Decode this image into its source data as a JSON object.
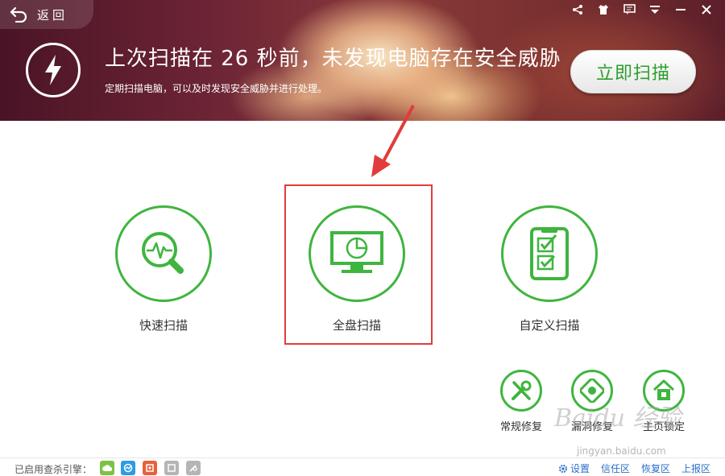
{
  "header": {
    "back_label": "返回",
    "title": "上次扫描在 26 秒前，未发现电脑存在安全威胁",
    "subtitle": "定期扫描电脑，可以及时发现安全威胁并进行处理。",
    "scan_now_label": "立即扫描"
  },
  "window_controls": [
    "share-icon",
    "skin-icon",
    "feedback-icon",
    "menu-icon",
    "minimize-icon",
    "close-icon"
  ],
  "scan_options": [
    {
      "label": "快速扫描",
      "icon": "pulse-magnifier-icon"
    },
    {
      "label": "全盘扫描",
      "icon": "monitor-icon",
      "highlighted": true
    },
    {
      "label": "自定义扫描",
      "icon": "checklist-icon"
    }
  ],
  "tools": [
    {
      "label": "常规修复",
      "icon": "wrench-screwdriver-icon"
    },
    {
      "label": "漏洞修复",
      "icon": "shield-patch-icon"
    },
    {
      "label": "主页锁定",
      "icon": "home-lock-icon"
    }
  ],
  "watermark": {
    "logo": "Baidu 经验",
    "url": "jingyan.baidu.com"
  },
  "footer": {
    "engines_label": "已启用查杀引擎：",
    "engines": [
      {
        "name": "cloud-engine-icon",
        "color": "#7dc243"
      },
      {
        "name": "qvm-engine-icon",
        "color": "#2f9be3"
      },
      {
        "name": "qex-engine-icon",
        "color": "#e8603c"
      },
      {
        "name": "avira-engine-icon",
        "color": "#b5b5b5"
      },
      {
        "name": "bitdefender-engine-icon",
        "color": "#b5b5b5"
      }
    ],
    "links": {
      "settings": "设置",
      "trust": "信任区",
      "restore": "恢复区",
      "report": "上报区"
    }
  },
  "colors": {
    "accent_green": "#3fb53f",
    "highlight_red": "#e23b3b",
    "link_blue": "#2a6fc7"
  }
}
